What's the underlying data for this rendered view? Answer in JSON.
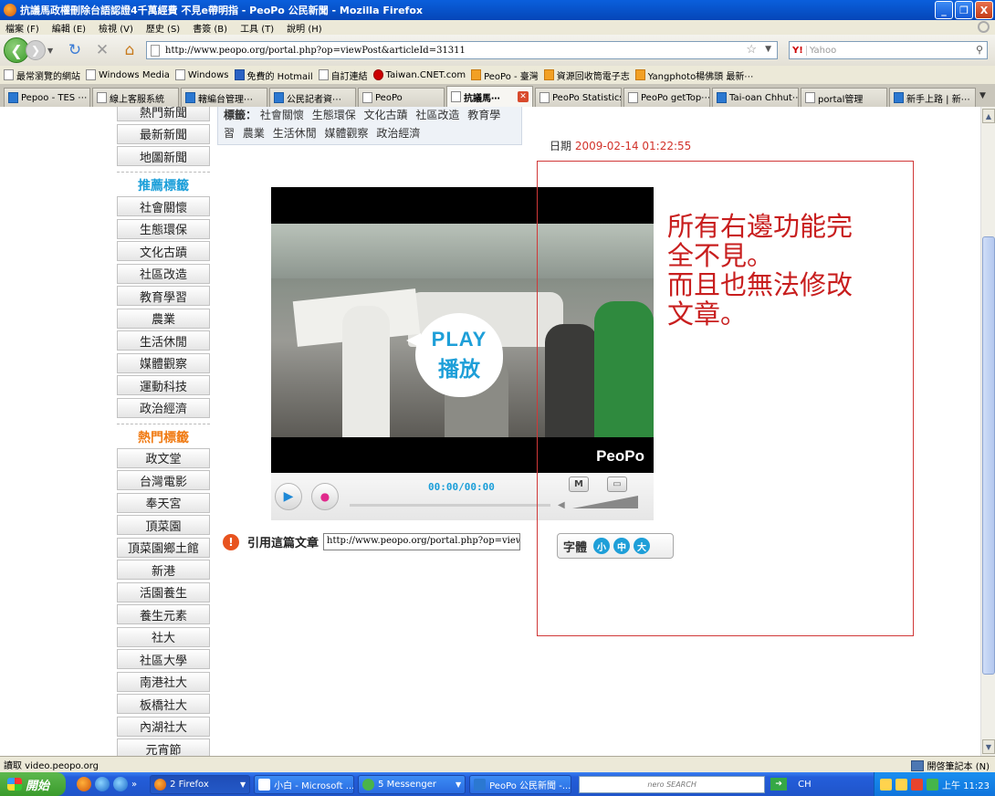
{
  "window": {
    "title": "抗議馬政權刪除台語認證4千萬經費 不見e帶明指 - PeoPo 公民新聞 - Mozilla Firefox",
    "minimize": "_",
    "restore": "❐",
    "close": "X"
  },
  "menu": [
    "檔案 (F)",
    "編輯 (E)",
    "檢視 (V)",
    "歷史 (S)",
    "書簽 (B)",
    "工具 (T)",
    "說明 (H)"
  ],
  "nav": {
    "url": "http://www.peopo.org/portal.php?op=viewPost&articleId=31311",
    "search_placeholder": "Yahoo",
    "search_engine": "Y!"
  },
  "bookmarks": [
    {
      "label": "最常瀏覽的網站",
      "icon": "page"
    },
    {
      "label": "Windows Media",
      "icon": "page"
    },
    {
      "label": "Windows",
      "icon": "page"
    },
    {
      "label": "免費的 Hotmail",
      "icon": "msn"
    },
    {
      "label": "自訂連結",
      "icon": "page"
    },
    {
      "label": "Taiwan.CNET.com",
      "icon": "cnet"
    },
    {
      "label": "PeoPo - 臺灣",
      "icon": "rss"
    },
    {
      "label": "資源回收筒電子志",
      "icon": "rss"
    },
    {
      "label": "Yangphoto楊佛頭 最新⋯",
      "icon": "rss"
    }
  ],
  "tabs": [
    {
      "label": "Pepoo - TES ⋯",
      "icon": "p",
      "active": false
    },
    {
      "label": "線上客服系統",
      "icon": "page",
      "active": false
    },
    {
      "label": "轄編台管理⋯",
      "icon": "p",
      "active": false
    },
    {
      "label": "公民記者資⋯",
      "icon": "p",
      "active": false
    },
    {
      "label": "PeoPo",
      "icon": "page",
      "active": false
    },
    {
      "label": "抗議馬⋯",
      "icon": "page",
      "active": true
    },
    {
      "label": "PeoPo Statistics",
      "icon": "page",
      "active": false
    },
    {
      "label": "PeoPo getTop⋯",
      "icon": "page",
      "active": false
    },
    {
      "label": "Tai-oan Chhut⋯",
      "icon": "p",
      "active": false
    },
    {
      "label": "portal管理",
      "icon": "page",
      "active": false
    },
    {
      "label": "新手上路 | 新⋯",
      "icon": "p",
      "active": false
    }
  ],
  "sidebar": {
    "top_items": [
      "熱門新聞",
      "最新新聞",
      "地圖新聞"
    ],
    "recommended_header": "推薦標籤",
    "recommended": [
      "社會關懷",
      "生態環保",
      "文化古蹟",
      "社區改造",
      "教育學習",
      "農業",
      "生活休閒",
      "媒體觀察",
      "運動科技",
      "政治經濟"
    ],
    "hot_header": "熱門標籤",
    "hot": [
      "政文堂",
      "台灣電影",
      "奉天宮",
      "頂菜園",
      "頂菜園鄉土館",
      "新港",
      "活園養生",
      "養生元素",
      "社大",
      "社區大學",
      "南港社大",
      "板橋社大",
      "內湖社大",
      "元宵節"
    ]
  },
  "article": {
    "tags_label": "標籤：",
    "tags": [
      "社會關懷",
      "生態環保",
      "文化古蹟",
      "社區改造",
      "教育學習",
      "農業",
      "生活休閒",
      "媒體觀察",
      "政治經濟"
    ],
    "date_label": "日期",
    "date_value": "2009-02-14 01:22:55",
    "video_play_en": "PLAY",
    "video_play_zh": "播放",
    "video_logo": "PeoPo",
    "timecode": "00:00/00:00",
    "m_button": "M",
    "cite_label": "引用這篇文章",
    "cite_value": "http://www.peopo.org/portal.php?op=viewP",
    "font_label": "字體",
    "font_small": "小",
    "font_medium": "中",
    "font_large": "大"
  },
  "annotation": {
    "line1": "所有右邊功能完",
    "line2": "全不見。",
    "line3": "而且也無法修改",
    "line4": "文章。"
  },
  "statusbar": {
    "text": "讀取 video.peopo.org",
    "right": "開啓筆記本 (N)"
  },
  "taskbar": {
    "start": "開始",
    "tasks": [
      {
        "label": "2 Firefox",
        "icon": "ff",
        "active": true
      },
      {
        "label": "小白 - Microsoft ...",
        "icon": "page",
        "active": false
      },
      {
        "label": "5 Messenger",
        "icon": "msn",
        "active": false
      },
      {
        "label": "PeoPo 公民新聞 -...",
        "icon": "p",
        "active": false
      }
    ],
    "nero": "nero SEARCH",
    "lang": "CH",
    "clock": "上午 11:23"
  }
}
